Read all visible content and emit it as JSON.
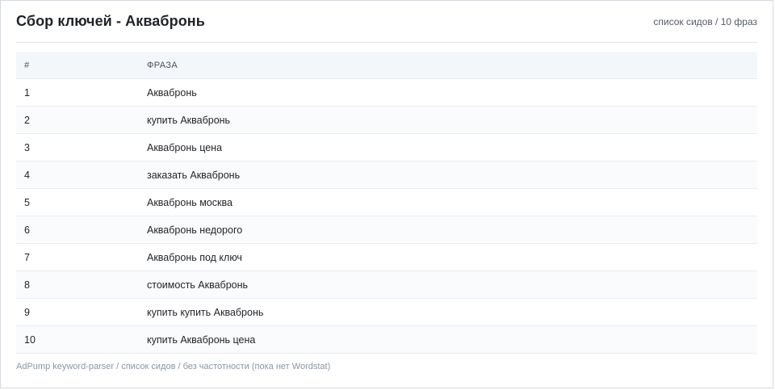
{
  "header": {
    "title": "Сбор ключей - Аквабронь",
    "meta": "список сидов / 10 фраз"
  },
  "table": {
    "columns": [
      "#",
      "ФРАЗА"
    ],
    "rows": [
      {
        "num": "1",
        "phrase": "Аквабронь"
      },
      {
        "num": "2",
        "phrase": "купить Аквабронь"
      },
      {
        "num": "3",
        "phrase": "Аквабронь цена"
      },
      {
        "num": "4",
        "phrase": "заказать Аквабронь"
      },
      {
        "num": "5",
        "phrase": "Аквабронь москва"
      },
      {
        "num": "6",
        "phrase": "Аквабронь недорого"
      },
      {
        "num": "7",
        "phrase": "Аквабронь под ключ"
      },
      {
        "num": "8",
        "phrase": "стоимость Аквабронь"
      },
      {
        "num": "9",
        "phrase": "купить купить Аквабронь"
      },
      {
        "num": "10",
        "phrase": "купить Аквабронь цена"
      }
    ]
  },
  "footer": {
    "text": "AdPump keyword-parser / список сидов / без частотности (пока нет Wordstat)"
  }
}
